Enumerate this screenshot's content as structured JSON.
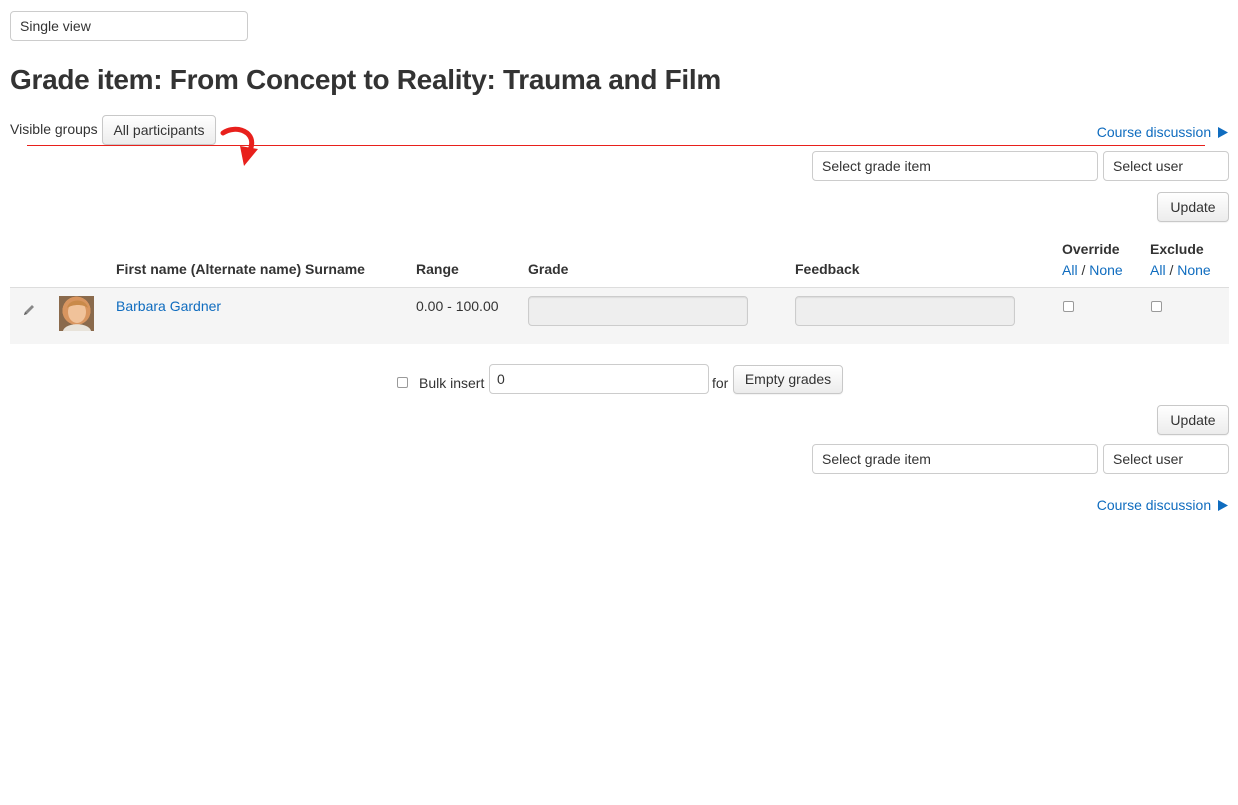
{
  "view_selector": {
    "value": "Single view"
  },
  "page_title": "Grade item: From Concept to Reality: Trauma and Film",
  "groups": {
    "label": "Visible groups",
    "value": "All participants"
  },
  "nav": {
    "course_link": "Course discussion",
    "select_grade_item": "Select grade item",
    "select_user": "Select user",
    "update_label": "Update"
  },
  "table": {
    "headers": {
      "name": "First name (Alternate name) Surname",
      "range": "Range",
      "grade": "Grade",
      "feedback": "Feedback",
      "override": "Override",
      "exclude": "Exclude"
    },
    "all_label": "All",
    "sep": "/",
    "none_label": "None",
    "rows": [
      {
        "name": "Barbara Gardner",
        "range": "0.00 - 100.00",
        "grade": "",
        "feedback": "",
        "override": false,
        "exclude": false
      }
    ]
  },
  "bulk": {
    "label": "Bulk insert",
    "value": "0",
    "for_label": "for",
    "option": "Empty grades"
  },
  "colors": {
    "link": "#0f6cbf",
    "annotation": "#e8201c",
    "row_bg": "#f5f5f5"
  },
  "icons": {
    "edit": "pencil-icon",
    "avatar": "user-avatar",
    "course_link_arrow": "triangle-right-icon",
    "annotation": "curved-arrow-annotation"
  }
}
